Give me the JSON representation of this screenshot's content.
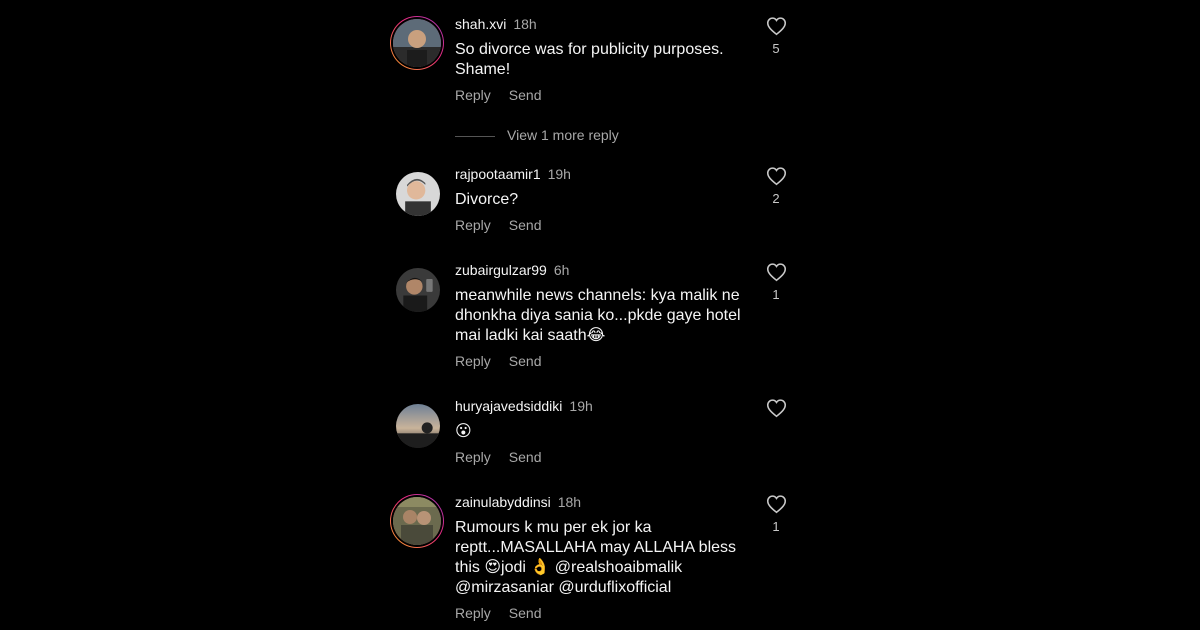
{
  "comments": [
    {
      "username": "shah.xvi",
      "time": "18h",
      "text": "So divorce was for publicity purposes. Shame!",
      "likes": "5",
      "reply_label": "Reply",
      "send_label": "Send",
      "avatar_style": "story"
    },
    {
      "username": "rajpootaamir1",
      "time": "19h",
      "text": "Divorce?",
      "likes": "2",
      "reply_label": "Reply",
      "send_label": "Send",
      "avatar_style": "plain"
    },
    {
      "username": "zubairgulzar99",
      "time": "6h",
      "text": "meanwhile news channels: kya malik ne dhonkha diya sania ko...pkde gaye hotel mai ladki kai saath😂",
      "likes": "1",
      "reply_label": "Reply",
      "send_label": "Send",
      "avatar_style": "plain"
    },
    {
      "username": "huryajavedsiddiki",
      "time": "19h",
      "text": "😮",
      "likes": "",
      "reply_label": "Reply",
      "send_label": "Send",
      "avatar_style": "plain"
    },
    {
      "username": "zainulabyddinsi",
      "time": "18h",
      "text": "Rumours k mu per ek jor ka reptt...MASALLAHA  may ALLAHA bless this 😍jodi 👌 @realshoaibmalik @mirzasaniar @urduflixofficial",
      "likes": "1",
      "reply_label": "Reply",
      "send_label": "Send",
      "avatar_style": "story"
    }
  ],
  "view_more_replies": "View 1 more reply",
  "icons": {
    "like": "heart-outline-icon"
  },
  "colors": {
    "background": "#000000",
    "primary_text": "#f5f5f5",
    "secondary_text": "#a8a8a8"
  }
}
